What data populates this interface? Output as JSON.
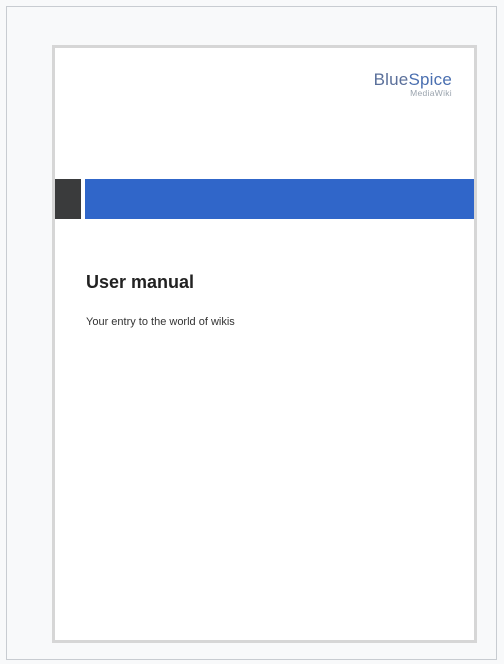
{
  "logo": {
    "word_blue": "Blue",
    "word_spice": "Spice",
    "sub": "MediaWiki"
  },
  "cover": {
    "title": "User manual",
    "subtitle": "Your entry to the world of wikis"
  },
  "colors": {
    "band_blue": "#3066c9",
    "band_dark": "#3a3b3c",
    "logo_blue": "#4a6fb0"
  }
}
